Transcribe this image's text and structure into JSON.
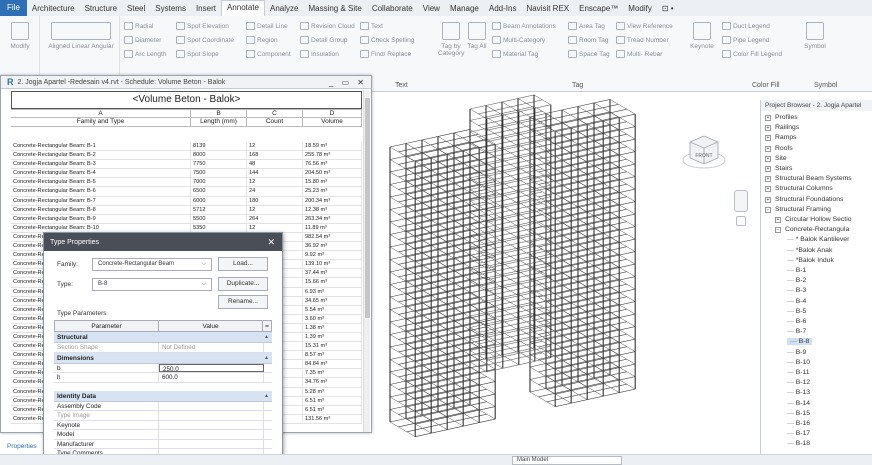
{
  "menu": {
    "file": "File",
    "items": [
      "Architecture",
      "Structure",
      "Steel",
      "Systems",
      "Insert",
      "Annotate",
      "Analyze",
      "Massing & Site",
      "Collaborate",
      "View",
      "Manage",
      "Add-Ins",
      "Navisit REX",
      "Enscape™",
      "Modify",
      "⊡ •"
    ]
  },
  "ribbon": {
    "modify": "Modify",
    "dim_tools": "Aligned Linear Angular",
    "radial": "Radial",
    "diameter": "Diameter",
    "arc_length": "Arc Length",
    "spot_elevation": "Spot Elevation",
    "spot_coordinate": "Spot Coordinate",
    "spot_slope": "Spot Slope",
    "detail_line": "Detail Line",
    "region": "Region",
    "component": "Component",
    "revision_cloud": "Revision Cloud",
    "detail_group": "Detail Group",
    "insulation": "Insulation",
    "text": "Text",
    "check_spelling": "Check Spelling",
    "find_replace": "Find/ Replace",
    "text_group": "Text",
    "tag_by_category": "Tag by Category",
    "tag_all": "Tag All",
    "beam_annotations": "Beam Annotations",
    "multi_category": "Multi-Category",
    "material_tag": "Material Tag",
    "area_tag": "Area Tag",
    "room_tag": "Room Tag",
    "space_tag": "Space Tag",
    "view_reference": "View Reference",
    "tread_number": "Tread Number",
    "multi_rebar": "Multi- Rebar",
    "tag_group": "Tag",
    "keynote": "Keynote",
    "duct_legend": "Duct Legend",
    "pipe_legend": "Pipe Legend",
    "color_fill_legend": "Color Fill Legend",
    "color_fill_group": "Color Fill",
    "symbol": "Symbol",
    "symbol_group": "Symbol"
  },
  "schedule": {
    "window_title": "2. Jogja Apartel -Redesain v4.rvt - Schedule: Volume Beton - Balok",
    "heading": "<Volume Beton - Balok>",
    "col_letters": [
      "A",
      "B",
      "C",
      "D"
    ],
    "col_headers": [
      "Family and Type",
      "Length (mm)",
      "Count",
      "Volume"
    ],
    "rows": [
      [
        "Concrete-Rectangular Beam: B-1",
        "8139",
        "12",
        "18.59 m³"
      ],
      [
        "Concrete-Rectangular Beam: B-2",
        "8000",
        "168",
        "255.78 m³"
      ],
      [
        "Concrete-Rectangular Beam: B-3",
        "7750",
        "48",
        "76.56 m³"
      ],
      [
        "Concrete-Rectangular Beam: B-4",
        "7500",
        "144",
        "204.50 m³"
      ],
      [
        "Concrete-Rectangular Beam: B-5",
        "7000",
        "12",
        "15.80 m³"
      ],
      [
        "Concrete-Rectangular Beam: B-6",
        "6500",
        "24",
        "25.23 m³"
      ],
      [
        "Concrete-Rectangular Beam: B-7",
        "6000",
        "180",
        "200.34 m³"
      ],
      [
        "Concrete-Rectangular Beam: B-8",
        "5712",
        "12",
        "12.38 m³"
      ],
      [
        "Concrete-Rectangular Beam: B-9",
        "5500",
        "264",
        "263.34 m³"
      ],
      [
        "Concrete-Rectangular Beam: B-10",
        "5350",
        "12",
        "11.89 m³"
      ],
      [
        "Concrete-Re",
        "",
        "",
        "982.54 m³"
      ],
      [
        "Concrete-Re",
        "",
        "",
        "36.92 m³"
      ],
      [
        "Concrete-Re",
        "",
        "",
        "9.92 m³"
      ],
      [
        "Concrete-Re",
        "",
        "",
        "139.10 m³"
      ],
      [
        "Concrete-Re",
        "",
        "",
        "37.44 m³"
      ],
      [
        "Concrete-Re",
        "",
        "",
        "15.66 m³"
      ],
      [
        "Concrete-Re",
        "",
        "",
        "6.93 m³"
      ],
      [
        "Concrete-Re",
        "",
        "",
        "34.65 m³"
      ],
      [
        "Concrete-Re",
        "",
        "",
        "5.54 m³"
      ],
      [
        "Concrete-Re",
        "",
        "",
        "3.60 m³"
      ],
      [
        "Concrete-Re",
        "",
        "",
        "1.38 m³"
      ],
      [
        "Concrete-Re",
        "",
        "",
        "1.39 m³"
      ],
      [
        "Concrete-Re",
        "",
        "",
        "15.31 m³"
      ],
      [
        "Concrete-Re",
        "",
        "",
        "8.57 m³"
      ],
      [
        "Concrete-Re",
        "",
        "",
        "84.84 m³"
      ],
      [
        "Concrete-Re",
        "",
        "",
        "7.35 m³"
      ],
      [
        "Concrete-Re",
        "",
        "",
        "34.76 m³"
      ],
      [
        "Concrete-Re",
        "",
        "",
        "5.28 m³"
      ],
      [
        "Concrete-Re",
        "",
        "",
        "6.51 m³"
      ],
      [
        "Concrete-Re",
        "",
        "",
        "6.51 m³"
      ],
      [
        "Concrete-Re",
        "",
        "",
        "131.56 m³"
      ]
    ]
  },
  "type_properties": {
    "title": "Type Properties",
    "family_label": "Family:",
    "family_value": "Concrete-Rectangular Beam",
    "type_label": "Type:",
    "type_value": "B-8",
    "load": "Load...",
    "duplicate": "Duplicate...",
    "rename": "Rename...",
    "type_parameters": "Type Parameters",
    "col_parameter": "Parameter",
    "col_value": "Value",
    "sec_structural": "Structural",
    "section_shape": "Section Shape",
    "section_shape_val": "Not Defined",
    "sec_dimensions": "Dimensions",
    "b": "b",
    "b_val": "250.0",
    "h": "h",
    "h_val": "600.0",
    "sec_identity": "Identity Data",
    "assembly_code": "Assembly Code",
    "type_image": "Type Image",
    "keynote": "Keynote",
    "model": "Model",
    "manufacturer": "Manufacturer",
    "type_comments": "Type Comments"
  },
  "properties_label": "Properties",
  "status": {
    "main_model": "Main Model"
  },
  "project_browser": {
    "title": "Project Browser - 2. Jogja Apartel",
    "items": [
      "Profiles",
      "Railings",
      "Ramps",
      "Roofs",
      "Site",
      "Stairs",
      "Structural Beam Systems",
      "Structural Columns",
      "Structural Foundations",
      "Structural Framing",
      "Circular Hollow Sectio",
      "Concrete-Rectangula",
      "* Balok Kantilever",
      "*Balok Anak",
      "*Balok Induk",
      "B-1",
      "B-2",
      "B-3",
      "B-4",
      "B-5",
      "B-6",
      "B-7",
      "B-8",
      "B-9",
      "B-10",
      "B-11",
      "B-12",
      "B-13",
      "B-14",
      "B-15",
      "B-16",
      "B-17",
      "B-18"
    ]
  },
  "viewcube": {
    "face": "FRONT"
  },
  "colors": {
    "accent": "#2f6fb6",
    "dialog_title": "#4a4f57",
    "section": "#d7e3f2",
    "selected": "#cfe0f5"
  }
}
